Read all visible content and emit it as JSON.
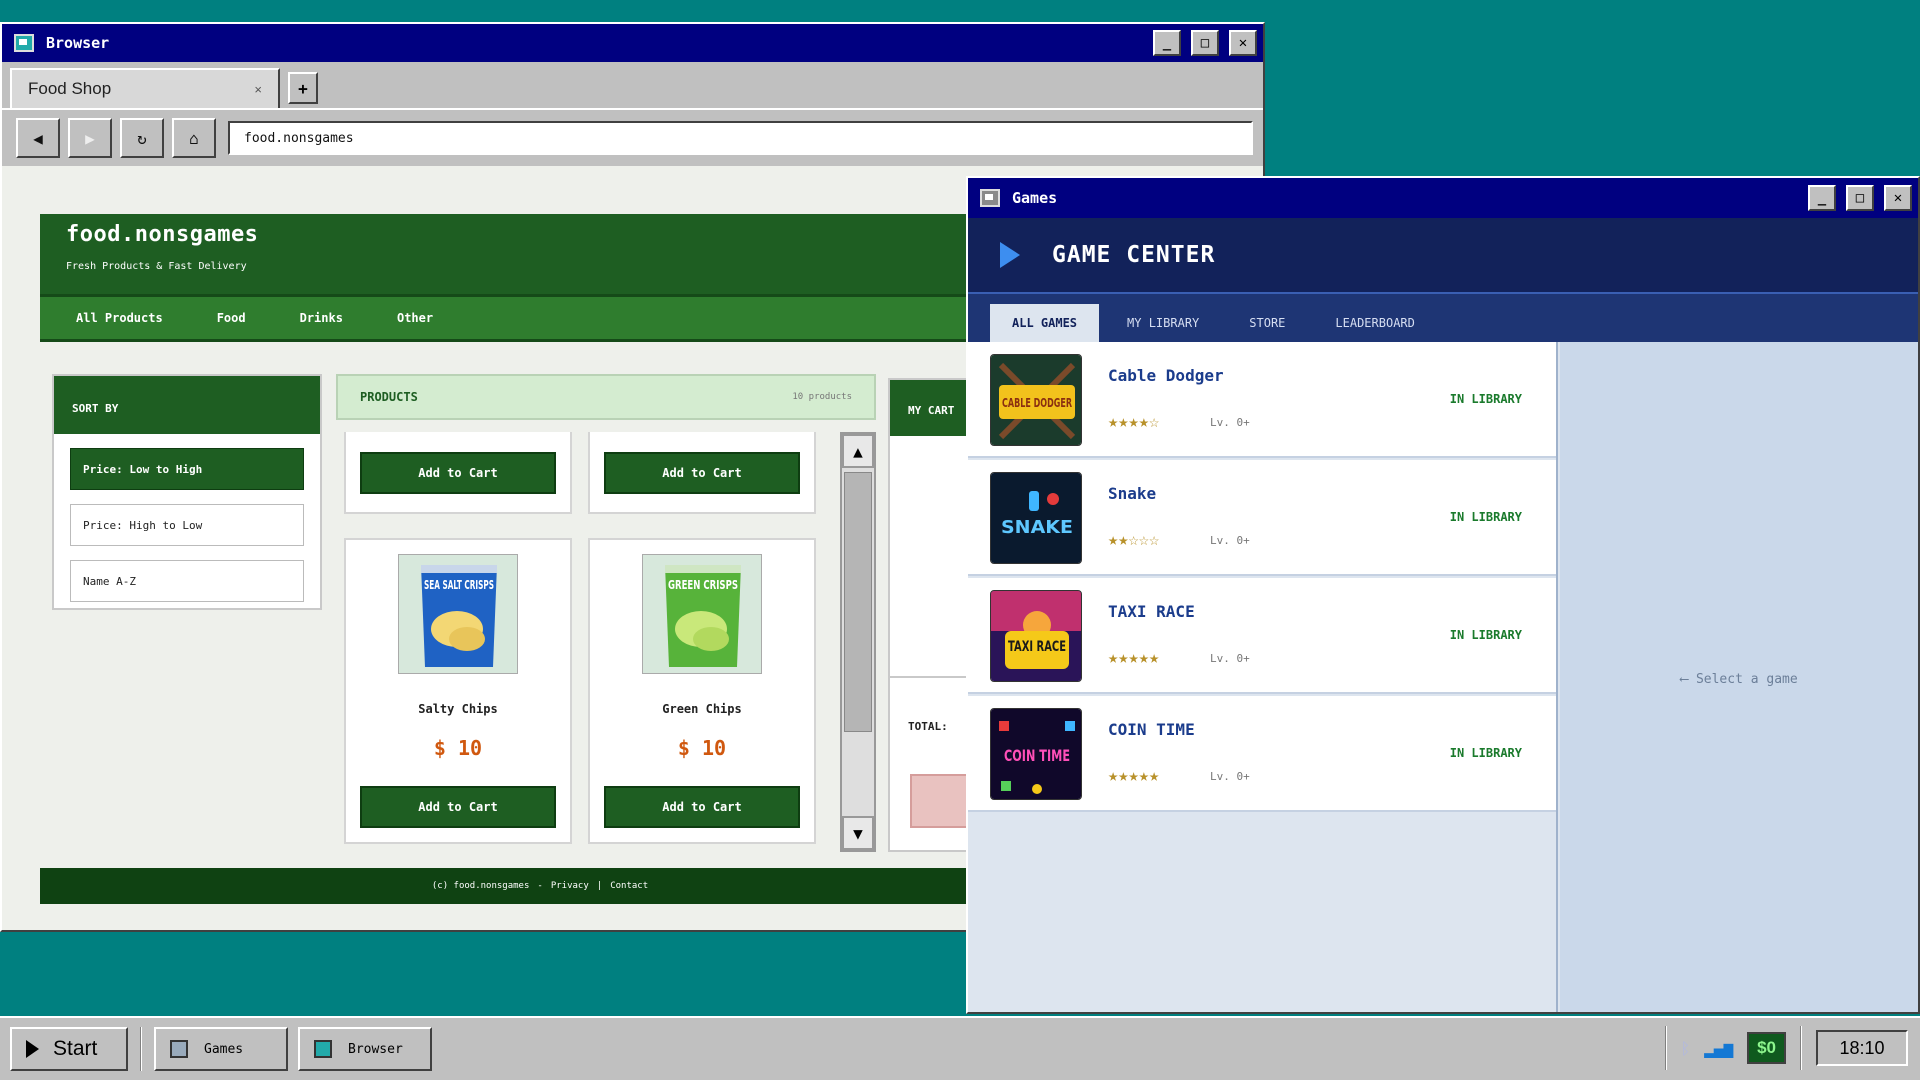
{
  "browser": {
    "title": "Browser",
    "tab_title": "Food Shop",
    "tab_close": "×",
    "new_tab": "+",
    "url": "food.nonsgames",
    "nav": {
      "back": "◀",
      "forward": "▶",
      "reload": "↻",
      "home": "⌂"
    },
    "minimize": "_",
    "maximize": "□",
    "close": "✕"
  },
  "site": {
    "title": "food.nonsgames",
    "tagline": "Fresh Products & Fast Delivery",
    "nav": [
      "All Products",
      "Food",
      "Drinks",
      "Other"
    ],
    "sort": {
      "heading": "SORT BY",
      "options": [
        "Price: Low to High",
        "Price: High to Low",
        "Name A-Z"
      ],
      "active_index": 0
    },
    "products_heading": "PRODUCTS",
    "products_count": "10 products",
    "add_to_cart": "Add to Cart",
    "products": [
      {
        "name": "Salty Chips",
        "price": "$ 10",
        "package_text": "SEA SALT CRISPS"
      },
      {
        "name": "Green Chips",
        "price": "$ 10",
        "package_text": "GREEN CRISPS"
      }
    ],
    "cart": {
      "heading": "MY CART",
      "total_label": "TOTAL:"
    },
    "footer": {
      "copyright": "(c) food.nonsgames",
      "sep1": "-",
      "privacy": "Privacy",
      "sep2": "|",
      "contact": "Contact"
    }
  },
  "games": {
    "title": "Games",
    "header": "GAME CENTER",
    "tabs": [
      "ALL GAMES",
      "MY LIBRARY",
      "STORE",
      "LEADERBOARD"
    ],
    "active_tab": 0,
    "detail_hint": "⟵ Select a game",
    "items": [
      {
        "name": "Cable Dodger",
        "stars": "★★★★☆",
        "rating": 4,
        "level": "Lv. 0+",
        "status": "IN LIBRARY",
        "thumb_text": "CABLE DODGER"
      },
      {
        "name": "Snake",
        "stars": "★★☆☆☆",
        "rating": 2,
        "level": "Lv. 0+",
        "status": "IN LIBRARY",
        "thumb_text": "SNAKE"
      },
      {
        "name": "TAXI RACE",
        "stars": "★★★★★",
        "rating": 5,
        "level": "Lv. 0+",
        "status": "IN LIBRARY",
        "thumb_text": "TAXI RACE"
      },
      {
        "name": "COIN TIME",
        "stars": "★★★★★",
        "rating": 5,
        "level": "Lv. 0+",
        "status": "IN LIBRARY",
        "thumb_text": "COIN TIME"
      }
    ]
  },
  "taskbar": {
    "start": "Start",
    "items": [
      "Games",
      "Browser"
    ],
    "money": "$0",
    "clock": "18:10"
  },
  "colors": {
    "desktop": "#008080",
    "titlebar": "#000080",
    "shop_green": "#1e5e22",
    "price_orange": "#d0580f",
    "game_header": "#12225a",
    "in_library": "#1a7a2c",
    "star_gold": "#b8912a"
  }
}
